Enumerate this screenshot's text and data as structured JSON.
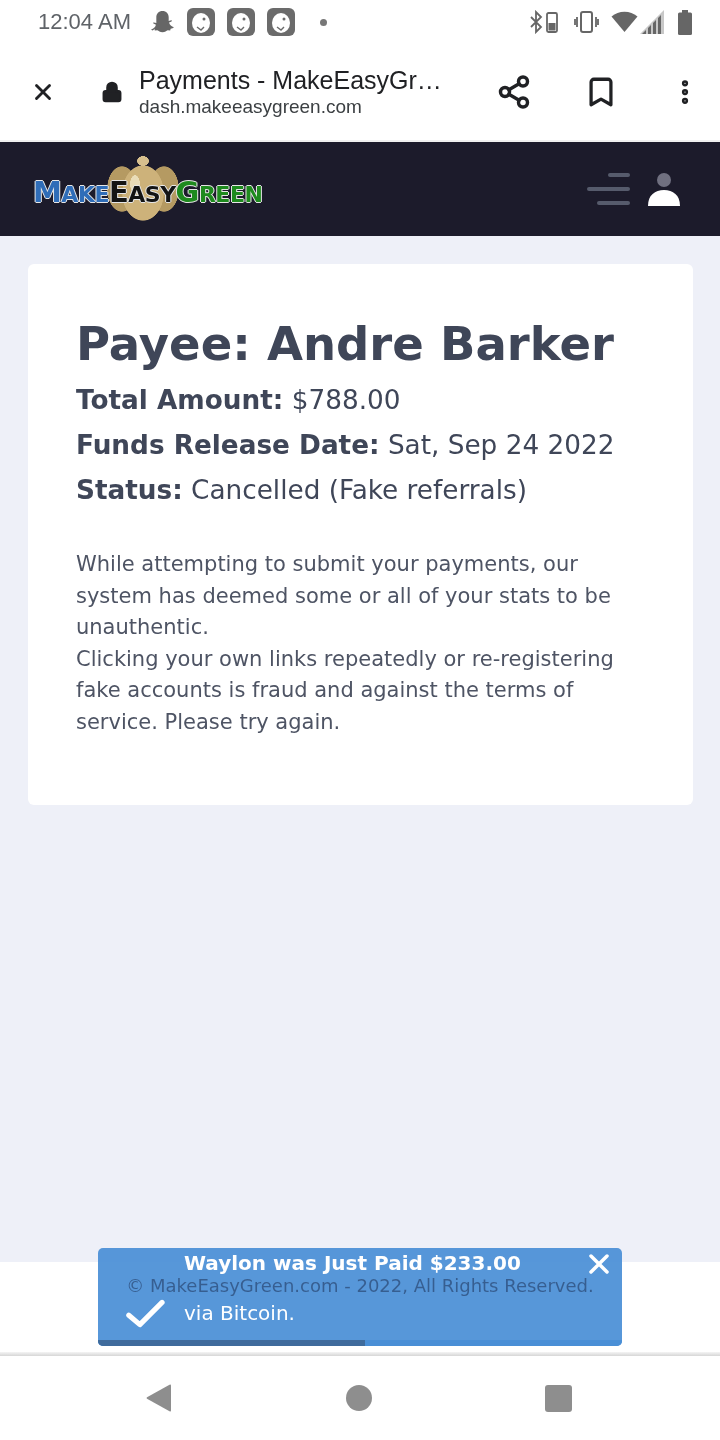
{
  "status_bar": {
    "time": "12:04 AM"
  },
  "browser": {
    "title": "Payments - MakeEasyGr…",
    "url": "dash.makeeasygreen.com"
  },
  "site_header": {
    "logo": [
      {
        "text": "MAKE",
        "color": "#2f6db8"
      },
      {
        "text": "EASY",
        "color": "#141414"
      },
      {
        "text": "GREEN",
        "color": "#1e8a1e"
      }
    ]
  },
  "payment": {
    "payee": "Payee: Andre Barker",
    "details": [
      "**Total Amount:** $788.00",
      "**Funds Release Date:** Sat, Sep 24 2022",
      "**Status:** Cancelled (Fake referrals)"
    ],
    "message": [
      "While attempting to submit your payments, our system has deemed some or all of your stats to be unauthentic.",
      "Clicking your own links repeatedly or re-registering fake accounts is fraud and against the terms of service. Please try again."
    ]
  },
  "footer": {
    "copyright": "© MakeEasyGreen.com - 2022, All Rights Reserved."
  },
  "toast": {
    "title": "Waylon was Just Paid $233.00",
    "message": "via Bitcoin.",
    "level": 0.51
  }
}
